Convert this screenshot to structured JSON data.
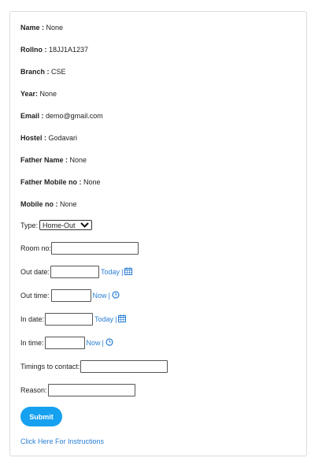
{
  "student": {
    "name_label": "Name :",
    "name_value": "None",
    "rollno_label": "Rollno :",
    "rollno_value": "18JJ1A1237",
    "branch_label": "Branch :",
    "branch_value": "CSE",
    "year_label": "Year:",
    "year_value": "None",
    "email_label": "Email :",
    "email_value": "demo@gmail.com",
    "hostel_label": "Hostel :",
    "hostel_value": "Godavari",
    "father_name_label": "Father Name :",
    "father_name_value": "None",
    "father_mobile_label": "Father Mobile no :",
    "father_mobile_value": "None",
    "mobile_label": "Mobile no :",
    "mobile_value": "None"
  },
  "form": {
    "type_label": "Type:",
    "type_selected": "Home-Out",
    "room_label": "Room no:",
    "room_value": "",
    "out_date_label": "Out date:",
    "out_date_value": "",
    "out_time_label": "Out time:",
    "out_time_value": "",
    "in_date_label": "In date:",
    "in_date_value": "",
    "in_time_label": "In time:",
    "in_time_value": "",
    "timings_label": "Timings to contact:",
    "timings_value": "",
    "reason_label": "Reason:",
    "reason_value": "",
    "today_link": "Today",
    "now_link": "Now",
    "separator": "|",
    "submit_label": "Submit",
    "instructions_link": "Click Here For Instructions"
  },
  "icons": {
    "calendar": "calendar-icon",
    "clock": "clock-icon"
  },
  "colors": {
    "accent": "#16a0f0",
    "link": "#2a7fd4"
  }
}
